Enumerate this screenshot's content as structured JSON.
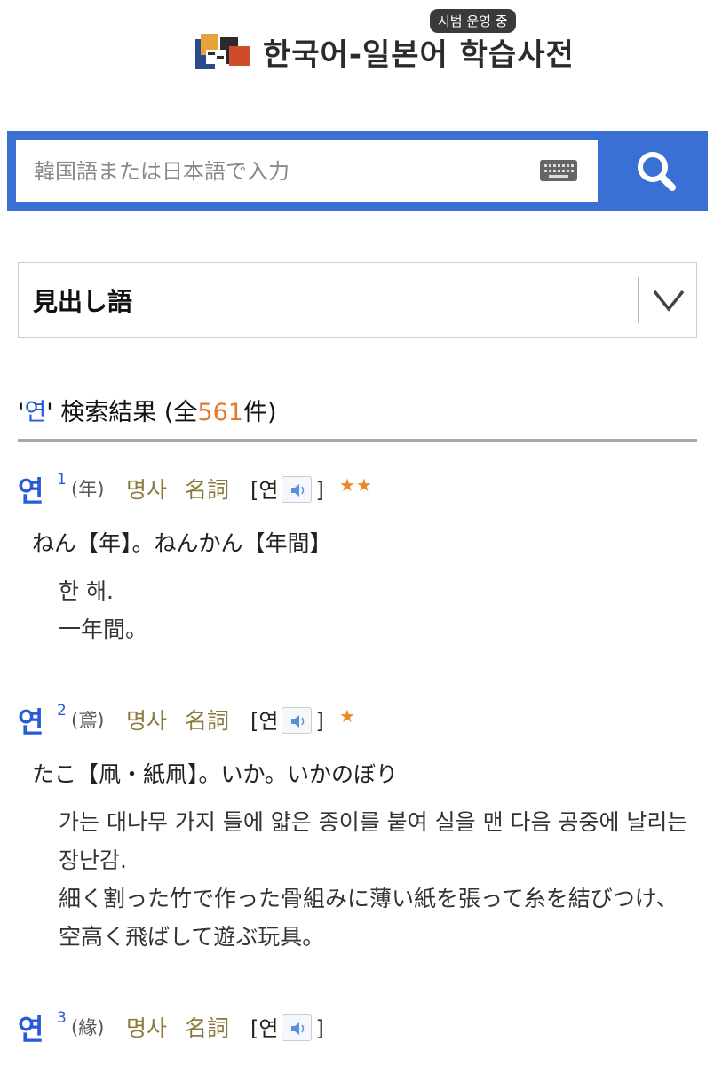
{
  "header": {
    "title_part1": "한국어-일본어",
    "title_part2": "학습사전",
    "trial_badge": "시범 운영 중"
  },
  "search": {
    "placeholder": "韓国語または日本語で入力"
  },
  "dropdown": {
    "selected": "見出し語"
  },
  "results": {
    "prefix": "'",
    "keyword": "연",
    "suffix_open": "' 検索結果 (全",
    "count": "561",
    "suffix_close": "件)"
  },
  "entries": [
    {
      "headword": "연",
      "sup": "1",
      "origin": "(年)",
      "pos_ko": "명사",
      "pos_ja": "名詞",
      "pron_open": "[연",
      "pron_close": "]",
      "stars": "★★",
      "translation": "ねん【年】。ねんかん【年間】",
      "def_ko": "한 해.",
      "def_ja": "一年間。"
    },
    {
      "headword": "연",
      "sup": "2",
      "origin": "(鳶)",
      "pos_ko": "명사",
      "pos_ja": "名詞",
      "pron_open": "[연",
      "pron_close": "]",
      "stars": "★",
      "translation": "たこ【凧・紙凧】。いか。いかのぼり",
      "def_ko": "가는 대나무 가지 틀에 얇은 종이를 붙여 실을 맨 다음 공중에 날리는 장난감.",
      "def_ja": "細く割った竹で作った骨組みに薄い紙を張って糸を結びつけ、空高く飛ばして遊ぶ玩具。"
    },
    {
      "headword": "연",
      "sup": "3",
      "origin": "(緣)",
      "pos_ko": "명사",
      "pos_ja": "名詞",
      "pron_open": "[연",
      "pron_close": "]"
    }
  ],
  "colors": {
    "brand_blue": "#3a6fd4",
    "headword_blue": "#2a5bd7",
    "accent_orange": "#e27a2d",
    "pos_olive": "#8a7a3e"
  }
}
